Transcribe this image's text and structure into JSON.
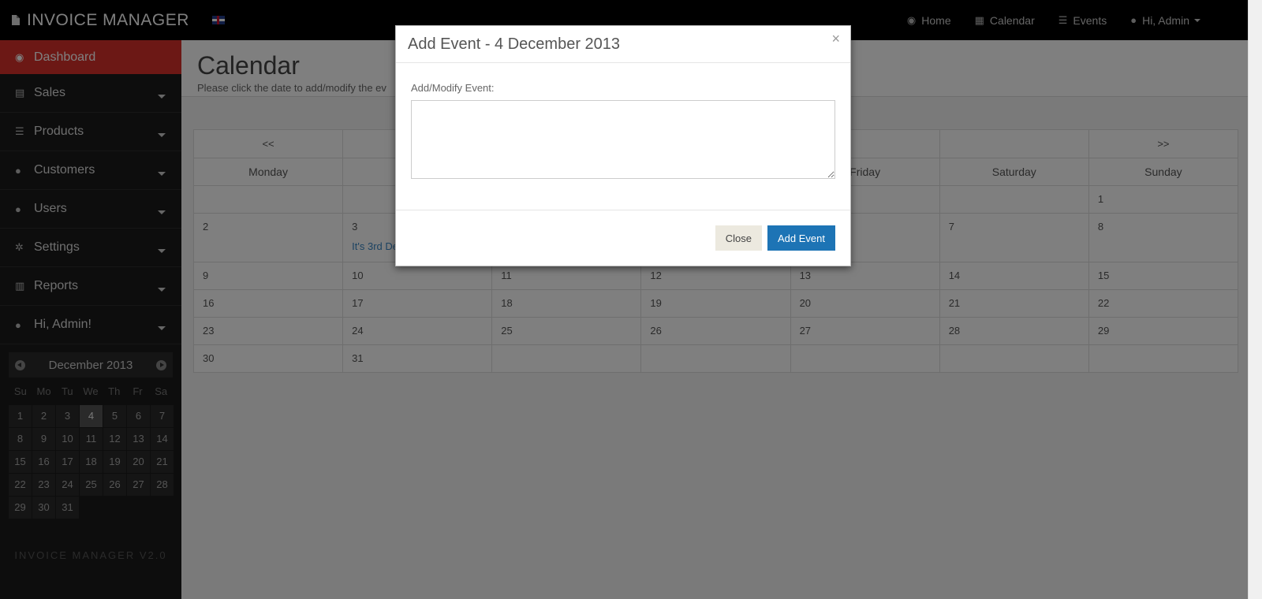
{
  "topbar": {
    "brand": "INVOICE MANAGER",
    "nav": [
      {
        "icon": "dashboard-icon",
        "glyph": "◉",
        "label": "Home"
      },
      {
        "icon": "calendar-icon",
        "glyph": "▦",
        "label": "Calendar"
      },
      {
        "icon": "list-icon",
        "glyph": "☰",
        "label": "Events"
      },
      {
        "icon": "user-icon",
        "glyph": "●",
        "label": "Hi, Admin"
      }
    ]
  },
  "sidebar": {
    "items": [
      {
        "label": "Dashboard",
        "glyph": "◉",
        "icon": "dashboard-icon"
      },
      {
        "label": "Sales",
        "glyph": "▤",
        "icon": "file-icon"
      },
      {
        "label": "Products",
        "glyph": "☰",
        "icon": "list-icon"
      },
      {
        "label": "Customers",
        "glyph": "●",
        "icon": "users-icon"
      },
      {
        "label": "Users",
        "glyph": "●",
        "icon": "users-icon"
      },
      {
        "label": "Settings",
        "glyph": "✲",
        "icon": "gear-icon"
      },
      {
        "label": "Reports",
        "glyph": "▥",
        "icon": "bar-chart-icon"
      },
      {
        "label": "Hi, Admin!",
        "glyph": "●",
        "icon": "user-icon"
      }
    ],
    "mini_calendar": {
      "month": "December 2013",
      "dows": [
        "Su",
        "Mo",
        "Tu",
        "We",
        "Th",
        "Fr",
        "Sa"
      ],
      "days": [
        "1",
        "2",
        "3",
        "4",
        "5",
        "6",
        "7",
        "8",
        "9",
        "10",
        "11",
        "12",
        "13",
        "14",
        "15",
        "16",
        "17",
        "18",
        "19",
        "20",
        "21",
        "22",
        "23",
        "24",
        "25",
        "26",
        "27",
        "28",
        "29",
        "30",
        "31"
      ],
      "today": "4"
    },
    "version": "INVOICE MANAGER V2.0"
  },
  "main": {
    "title": "Calendar",
    "subtitle": "Please click the date to add/modify the ev",
    "calendar": {
      "prev": "<<",
      "next": ">>",
      "dows": [
        "Monday",
        "",
        "",
        "",
        "Friday",
        "Saturday",
        "Sunday"
      ],
      "weeks": [
        [
          "",
          "",
          "",
          "",
          "",
          "",
          "1"
        ],
        [
          "2",
          "3",
          "",
          "",
          "",
          "7",
          "8"
        ],
        [
          "9",
          "10",
          "11",
          "12",
          "13",
          "14",
          "15"
        ],
        [
          "16",
          "17",
          "18",
          "19",
          "20",
          "21",
          "22"
        ],
        [
          "23",
          "24",
          "25",
          "26",
          "27",
          "28",
          "29"
        ],
        [
          "30",
          "31",
          "",
          "",
          "",
          "",
          ""
        ]
      ],
      "event": {
        "week": 1,
        "day": 1,
        "text": "It's 3rd De"
      }
    }
  },
  "modal": {
    "title": "Add Event - 4 December 2013",
    "close_glyph": "×",
    "label": "Add/Modify Event:",
    "value": "",
    "close_button": "Close",
    "add_button": "Add Event"
  }
}
